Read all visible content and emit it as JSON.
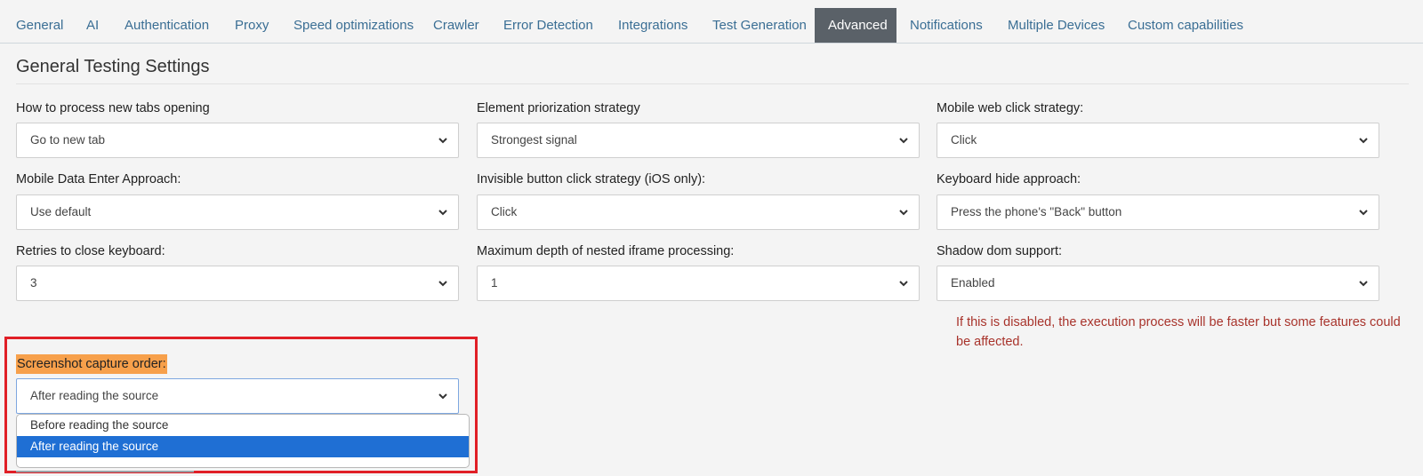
{
  "tabs": [
    {
      "label": "General",
      "active": false
    },
    {
      "label": "AI",
      "active": false
    },
    {
      "label": "Authentication",
      "active": false
    },
    {
      "label": "Proxy",
      "active": false
    },
    {
      "label": "Speed optimizations",
      "active": false
    },
    {
      "label": "Crawler",
      "active": false
    },
    {
      "label": "Error Detection",
      "active": false
    },
    {
      "label": "Integrations",
      "active": false
    },
    {
      "label": "Test Generation",
      "active": false
    },
    {
      "label": "Advanced",
      "active": true
    },
    {
      "label": "Notifications",
      "active": false
    },
    {
      "label": "Multiple Devices",
      "active": false
    },
    {
      "label": "Custom capabilities",
      "active": false
    }
  ],
  "section_title": "General Testing Settings",
  "fields": [
    {
      "label": "How to process new tabs opening",
      "value": "Go to new tab"
    },
    {
      "label": "Element priorization strategy",
      "value": "Strongest signal"
    },
    {
      "label": "Mobile web click strategy:",
      "value": "Click"
    },
    {
      "label": "Mobile Data Enter Approach:",
      "value": "Use default"
    },
    {
      "label": "Invisible button click strategy (iOS only):",
      "value": "Click"
    },
    {
      "label": "Keyboard hide approach:",
      "value": "Press the phone's \"Back\" button"
    },
    {
      "label": "Retries to close keyboard:",
      "value": "3"
    },
    {
      "label": "Maximum depth of nested iframe processing:",
      "value": "1"
    },
    {
      "label": "Shadow dom support:",
      "value": "Enabled"
    }
  ],
  "shadow_dom_warning": "If this is disabled, the execution process will be faster but some features could be affected.",
  "screenshot_order": {
    "label": "Screenshot capture order:",
    "value": "After reading the source",
    "options": [
      "Before reading the source",
      "After reading the source"
    ],
    "selected_index": 1
  },
  "colors": {
    "tab_text": "#3a6e94",
    "active_tab_bg": "#5a6168",
    "warning_text": "#a8332b",
    "highlight": "#f7a04b",
    "annotation_border": "#e01f26",
    "selected_option_bg": "#1f6fd4"
  },
  "icons": {
    "select_arrow": "chevron-down-icon"
  }
}
